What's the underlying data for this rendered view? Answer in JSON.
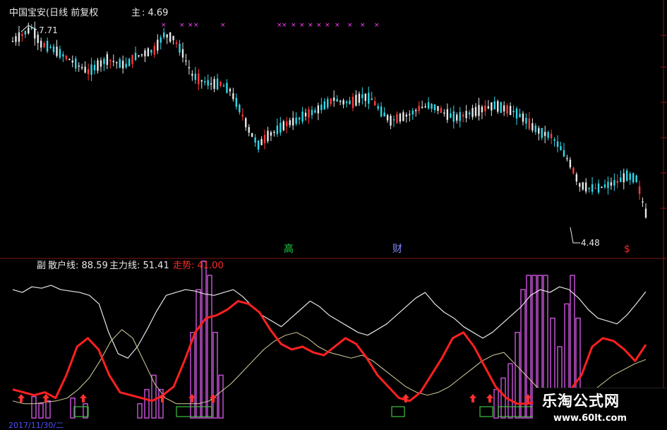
{
  "main_panel": {
    "title": "中国宝安(日线 前复权",
    "main_label": "主",
    "main_value": ": 4.69",
    "high_marker": "7.71",
    "low_marker": "4.48",
    "event_labels": [
      {
        "text": "高",
        "color": "#22cc44"
      },
      {
        "text": "财",
        "color": "#8888ff"
      },
      {
        "text": "$",
        "color": "#ff2222"
      }
    ]
  },
  "indicator_panel": {
    "prefix": "副",
    "retail_label": "散户线: 88.59",
    "main_force_label": "主力线: 51.41",
    "trend_label": "走势: 41.00",
    "date_text": "2017/11/30/二"
  },
  "watermark": {
    "line1": "乐淘公式网",
    "line2": "www.60lt.com"
  },
  "colors": {
    "up_candle": "#e8e8e8",
    "down_candle": "#30d8e8",
    "red_candle": "#ff3b3b",
    "retail_line": "#e6e6e6",
    "main_force_line": "#ff2020",
    "trend_line": "#d8d0a0",
    "volume_bars": "#c050d0",
    "markers": "#ff40ff",
    "grid": "#801818"
  },
  "chart_data": {
    "type": "line",
    "price_series": [
      7.5,
      7.6,
      7.71,
      7.45,
      7.4,
      7.3,
      7.2,
      7.1,
      7.0,
      7.1,
      7.2,
      7.15,
      7.1,
      7.25,
      7.3,
      7.35,
      7.6,
      7.55,
      7.3,
      6.95,
      6.85,
      6.8,
      6.8,
      6.7,
      6.4,
      6.05,
      5.8,
      5.95,
      6.05,
      6.15,
      6.2,
      6.3,
      6.35,
      6.45,
      6.55,
      6.5,
      6.5,
      6.6,
      6.55,
      6.35,
      6.2,
      6.25,
      6.3,
      6.4,
      6.45,
      6.4,
      6.3,
      6.25,
      6.3,
      6.35,
      6.4,
      6.45,
      6.4,
      6.35,
      6.25,
      6.1,
      6.0,
      5.95,
      5.75,
      5.5,
      5.15,
      5.1,
      5.1,
      5.15,
      5.2,
      5.3,
      5.25,
      4.69
    ],
    "price_range": [
      4.48,
      7.71
    ],
    "retail_line": [
      90,
      88,
      92,
      91,
      93,
      90,
      89,
      88,
      86,
      80,
      60,
      45,
      42,
      50,
      62,
      75,
      86,
      88,
      90,
      89,
      87,
      86,
      88,
      90,
      85,
      78,
      72,
      68,
      64,
      70,
      76,
      82,
      78,
      72,
      68,
      64,
      60,
      58,
      62,
      66,
      72,
      78,
      84,
      88,
      80,
      74,
      70,
      64,
      60,
      56,
      60,
      66,
      72,
      78,
      86,
      90,
      88,
      92,
      90,
      84,
      76,
      70,
      68,
      66,
      72,
      80,
      88.59
    ],
    "main_force_line": [
      20,
      18,
      16,
      18,
      14,
      30,
      50,
      56,
      48,
      30,
      18,
      16,
      14,
      12,
      16,
      22,
      40,
      60,
      70,
      72,
      76,
      82,
      80,
      74,
      62,
      52,
      48,
      50,
      46,
      44,
      50,
      56,
      52,
      42,
      30,
      22,
      14,
      12,
      18,
      30,
      42,
      56,
      60,
      50,
      36,
      22,
      14,
      10,
      10,
      12,
      14,
      16,
      20,
      30,
      50,
      56,
      54,
      48,
      40,
      51.41
    ],
    "trend_line": [
      12,
      10,
      10,
      11,
      12,
      14,
      20,
      28,
      40,
      54,
      62,
      56,
      40,
      24,
      14,
      10,
      10,
      10,
      12,
      18,
      24,
      32,
      40,
      48,
      54,
      58,
      60,
      56,
      50,
      46,
      44,
      42,
      44,
      40,
      34,
      28,
      22,
      18,
      16,
      18,
      22,
      28,
      34,
      40,
      44,
      46,
      38,
      30,
      22,
      16,
      12,
      12,
      14,
      18,
      24,
      30,
      34,
      38,
      41
    ],
    "retail_range": [
      0,
      100
    ]
  }
}
